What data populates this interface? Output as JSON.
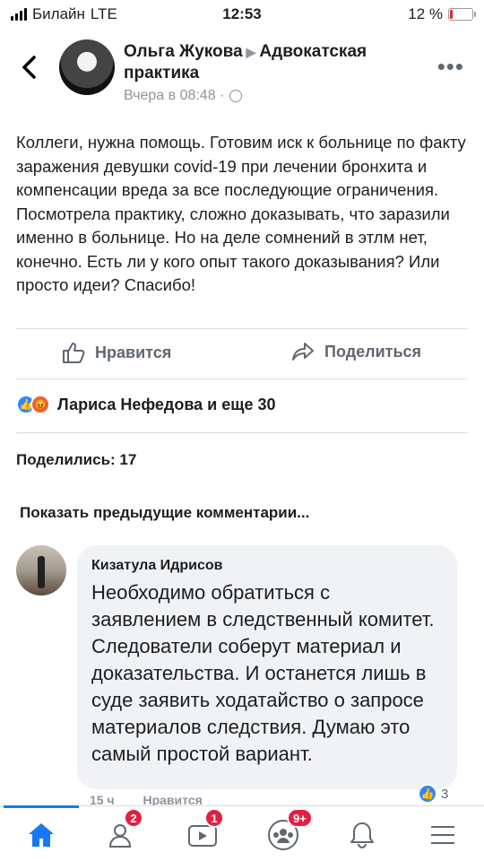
{
  "status_bar": {
    "carrier": "Билайн",
    "network": "LTE",
    "time": "12:53",
    "battery_text": "12 %",
    "battery_level": 0.12
  },
  "post": {
    "author": "Ольга Жукова",
    "group": "Адвокатская практика",
    "time": "Вчера в 08:48 ·",
    "text": "Коллеги, нужна помощь. Готовим иск к больнице по факту заражения девушки covid-19 при лечении бронхита и компенсации вреда за все последующие ограничения. Посмотрела практику, сложно доказывать, что заразили именно в больнице. Но на деле сомнений в этлм нет, конечно. Есть ли у кого опыт такого доказывания? Или просто идеи? Спасибо!",
    "actions": {
      "like": "Нравится",
      "share": "Поделиться"
    },
    "reactions_text": "Лариса Нефедова и еще 30",
    "shares_text": "Поделились: 17",
    "prev_comments": "Показать предыдущие комментарии..."
  },
  "comment": {
    "author": "Кизатула Идрисов",
    "text": "Необходимо обратиться с заявлением в следственный комитет. Следователи соберут материал и доказательства. И останется  лишь в суде заявить ходатайство о запросе материалов следствия. Думаю это самый простой вариант.",
    "time": "15 ч",
    "like": "Нравится",
    "likes_count": "3"
  },
  "nav": {
    "badges": {
      "friends": "2",
      "watch": "1",
      "groups": "9+"
    },
    "icons": [
      "home-icon",
      "friends-icon",
      "watch-icon",
      "groups-icon",
      "bell-icon",
      "menu-icon"
    ]
  },
  "colors": {
    "accent": "#1877f2",
    "badge": "#e41e3f",
    "battery": "#e02424"
  }
}
